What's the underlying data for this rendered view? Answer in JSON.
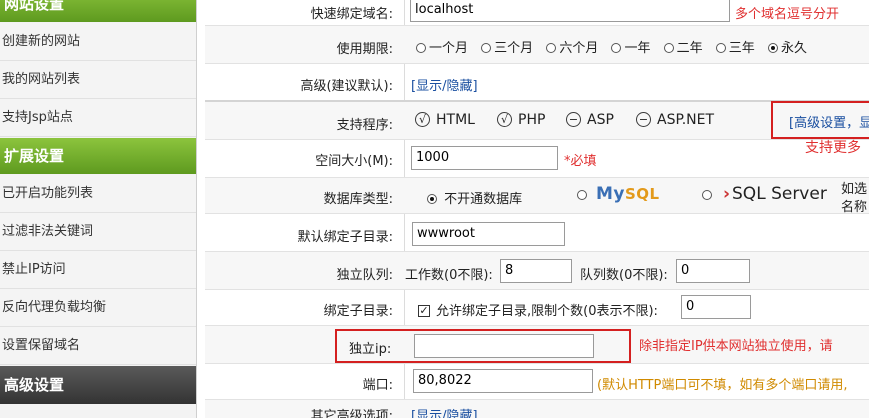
{
  "sidebar": {
    "items": [
      {
        "label": "网站设置",
        "type": "head",
        "style": "green"
      },
      {
        "label": "创建新的网站",
        "type": "item"
      },
      {
        "label": "我的网站列表",
        "type": "item"
      },
      {
        "label": "支持Jsp站点",
        "type": "item"
      },
      {
        "label": "扩展设置",
        "type": "head",
        "style": "green"
      },
      {
        "label": "已开启功能列表",
        "type": "item"
      },
      {
        "label": "过滤非法关键词",
        "type": "item"
      },
      {
        "label": "禁止IP访问",
        "type": "item"
      },
      {
        "label": "反向代理负载均衡",
        "type": "item"
      },
      {
        "label": "设置保留域名",
        "type": "item"
      },
      {
        "label": "高级设置",
        "type": "head",
        "style": "dark"
      }
    ]
  },
  "form": {
    "domain": {
      "label": "快速绑定域名:",
      "value": "localhost",
      "hint": "多个域名逗号分开"
    },
    "period": {
      "label": "使用期限:",
      "options": [
        "一个月",
        "三个月",
        "六个月",
        "一年",
        "二年",
        "三年",
        "永久"
      ],
      "selected": "永久"
    },
    "advanced": {
      "label": "高级(建议默认):",
      "link": "[显示/隐藏]"
    },
    "programs": {
      "label": "支持程序:",
      "items": [
        {
          "name": "HTML",
          "icon": "checkmark-circle-icon",
          "glyph": "√"
        },
        {
          "name": "PHP",
          "icon": "checkmark-circle-icon",
          "glyph": "√"
        },
        {
          "name": "ASP",
          "icon": "minus-circle-icon",
          "glyph": "−"
        },
        {
          "name": "ASP.NET",
          "icon": "minus-circle-icon",
          "glyph": "−"
        }
      ],
      "adv_link": "[高级设置，显",
      "adv_hint": "支持更多"
    },
    "space": {
      "label": "空间大小(M):",
      "value": "1000",
      "required": "*必填"
    },
    "db": {
      "label": "数据库类型:",
      "none_option": "不开通数据库",
      "mysql_text": "MySQL",
      "sqlserver_text": "SQL Server",
      "selected": "none",
      "hint_line1": "如选",
      "hint_line2": "名称"
    },
    "subdir_default": {
      "label": "默认绑定子目录:",
      "value": "wwwroot"
    },
    "queue": {
      "label": "独立队列:",
      "worker_label": "工作数(0不限):",
      "worker_value": "8",
      "queue_label": "队列数(0不限):",
      "queue_value": "0"
    },
    "bind_subdir": {
      "label": "绑定子目录:",
      "checkbox_label": "允许绑定子目录,限制个数(0表示不限):",
      "checked": true,
      "value": "0"
    },
    "ip": {
      "label": "独立ip:",
      "value": "",
      "hint": "除非指定IP供本网站独立使用，请"
    },
    "port": {
      "label": "端口:",
      "value": "80,8022",
      "hint": "(默认HTTP端口可不填，如有多个端口请用,"
    },
    "other": {
      "label": "其它高级选项:",
      "link": "[显示/隐藏]"
    }
  },
  "colors": {
    "accent_green": "#6fae2a",
    "dark_head": "#3f3f3f",
    "alert_red": "#d42020",
    "link_blue": "#1a4fa0"
  }
}
